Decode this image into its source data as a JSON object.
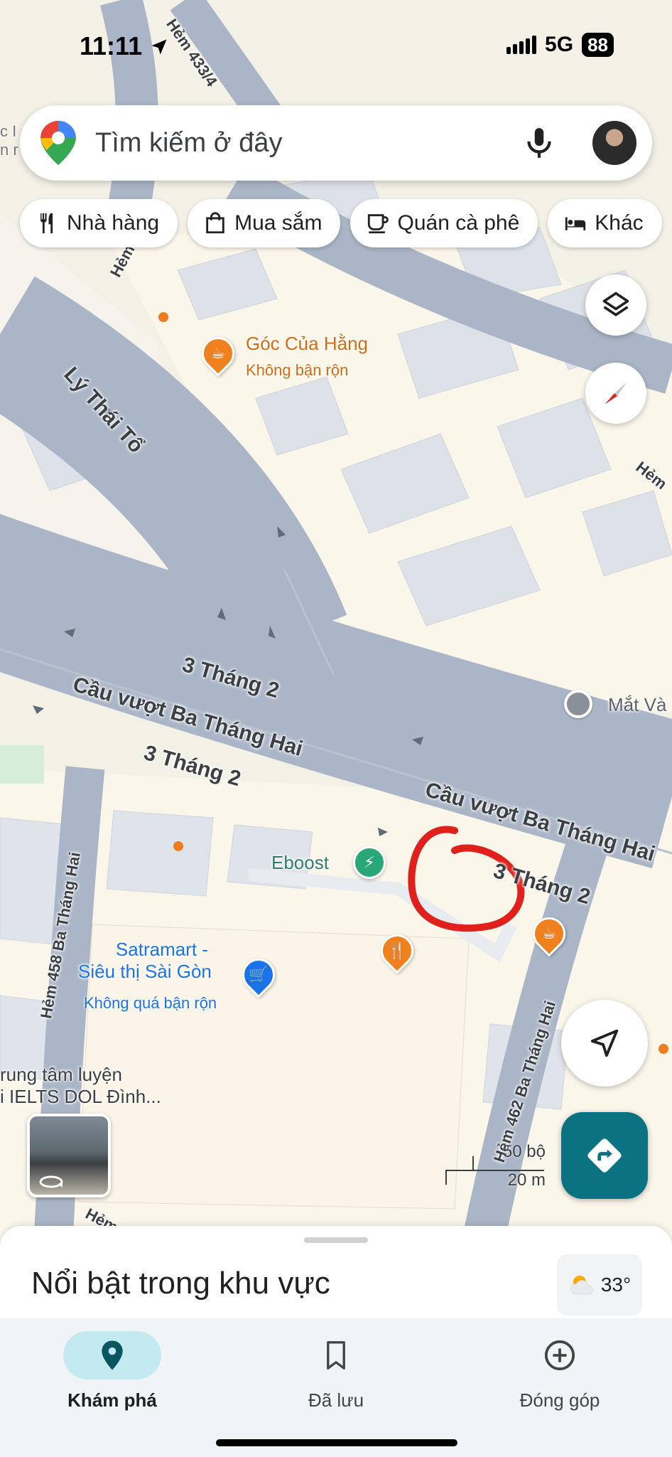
{
  "status_bar": {
    "time": "11:11",
    "network": "5G",
    "battery": "88"
  },
  "search": {
    "placeholder": "Tìm kiếm ở đây"
  },
  "chips": [
    {
      "label": "Nhà hàng",
      "icon": "fork-knife-icon"
    },
    {
      "label": "Mua sắm",
      "icon": "shopping-bag-icon"
    },
    {
      "label": "Quán cà phê",
      "icon": "coffee-cup-icon"
    },
    {
      "label": "Khác",
      "icon": "bed-icon"
    }
  ],
  "map": {
    "roads": {
      "ly_thai_to": "Lý Thái Tổ",
      "three_thang_2_a": "3 Tháng 2",
      "overpass_a": "Cầu vượt Ba Tháng Hai",
      "three_thang_2_b": "3 Tháng 2",
      "overpass_b": "Cầu vượt Ba Tháng Hai",
      "three_thang_2_c": "3 Tháng 2",
      "hem_458": "Hẻm 458 Ba Tháng Hai",
      "hem_462": "Hẻm 462 Ba Tháng Hai",
      "hem_433": "Hẻm 433/4",
      "hem_top": "Hẻm",
      "hem_right": "Hẻm",
      "hem_bottom": "Hẻm"
    },
    "pois": {
      "goc_cua_hang": {
        "name": "Góc Của Hằng",
        "status": "Không bận rộn"
      },
      "eboost": {
        "name": "Eboost"
      },
      "satramart": {
        "name_line1": "Satramart -",
        "name_line2": "Siêu thị Sài Gòn",
        "status": "Không quá bận rộn"
      },
      "dol": {
        "name_line1": "rung tâm luyện",
        "name_line2": "i IELTS DOL Đình..."
      },
      "mat_vang": {
        "name": "Mắt Và"
      },
      "partial_left": {
        "line1": "c I",
        "line2": "n r"
      }
    },
    "scale": {
      "feet": "50 bộ",
      "meters": "20 m"
    },
    "colors": {
      "road": "#aab6c7",
      "block": "#fdf8ec",
      "building": "#dfe3ea",
      "annotation": "#e0201b",
      "accent": "#0b7282"
    }
  },
  "sheet": {
    "title": "Nổi bật trong khu vực",
    "temperature": "33°"
  },
  "nav": {
    "explore": "Khám phá",
    "saved": "Đã lưu",
    "contribute": "Đóng góp"
  }
}
